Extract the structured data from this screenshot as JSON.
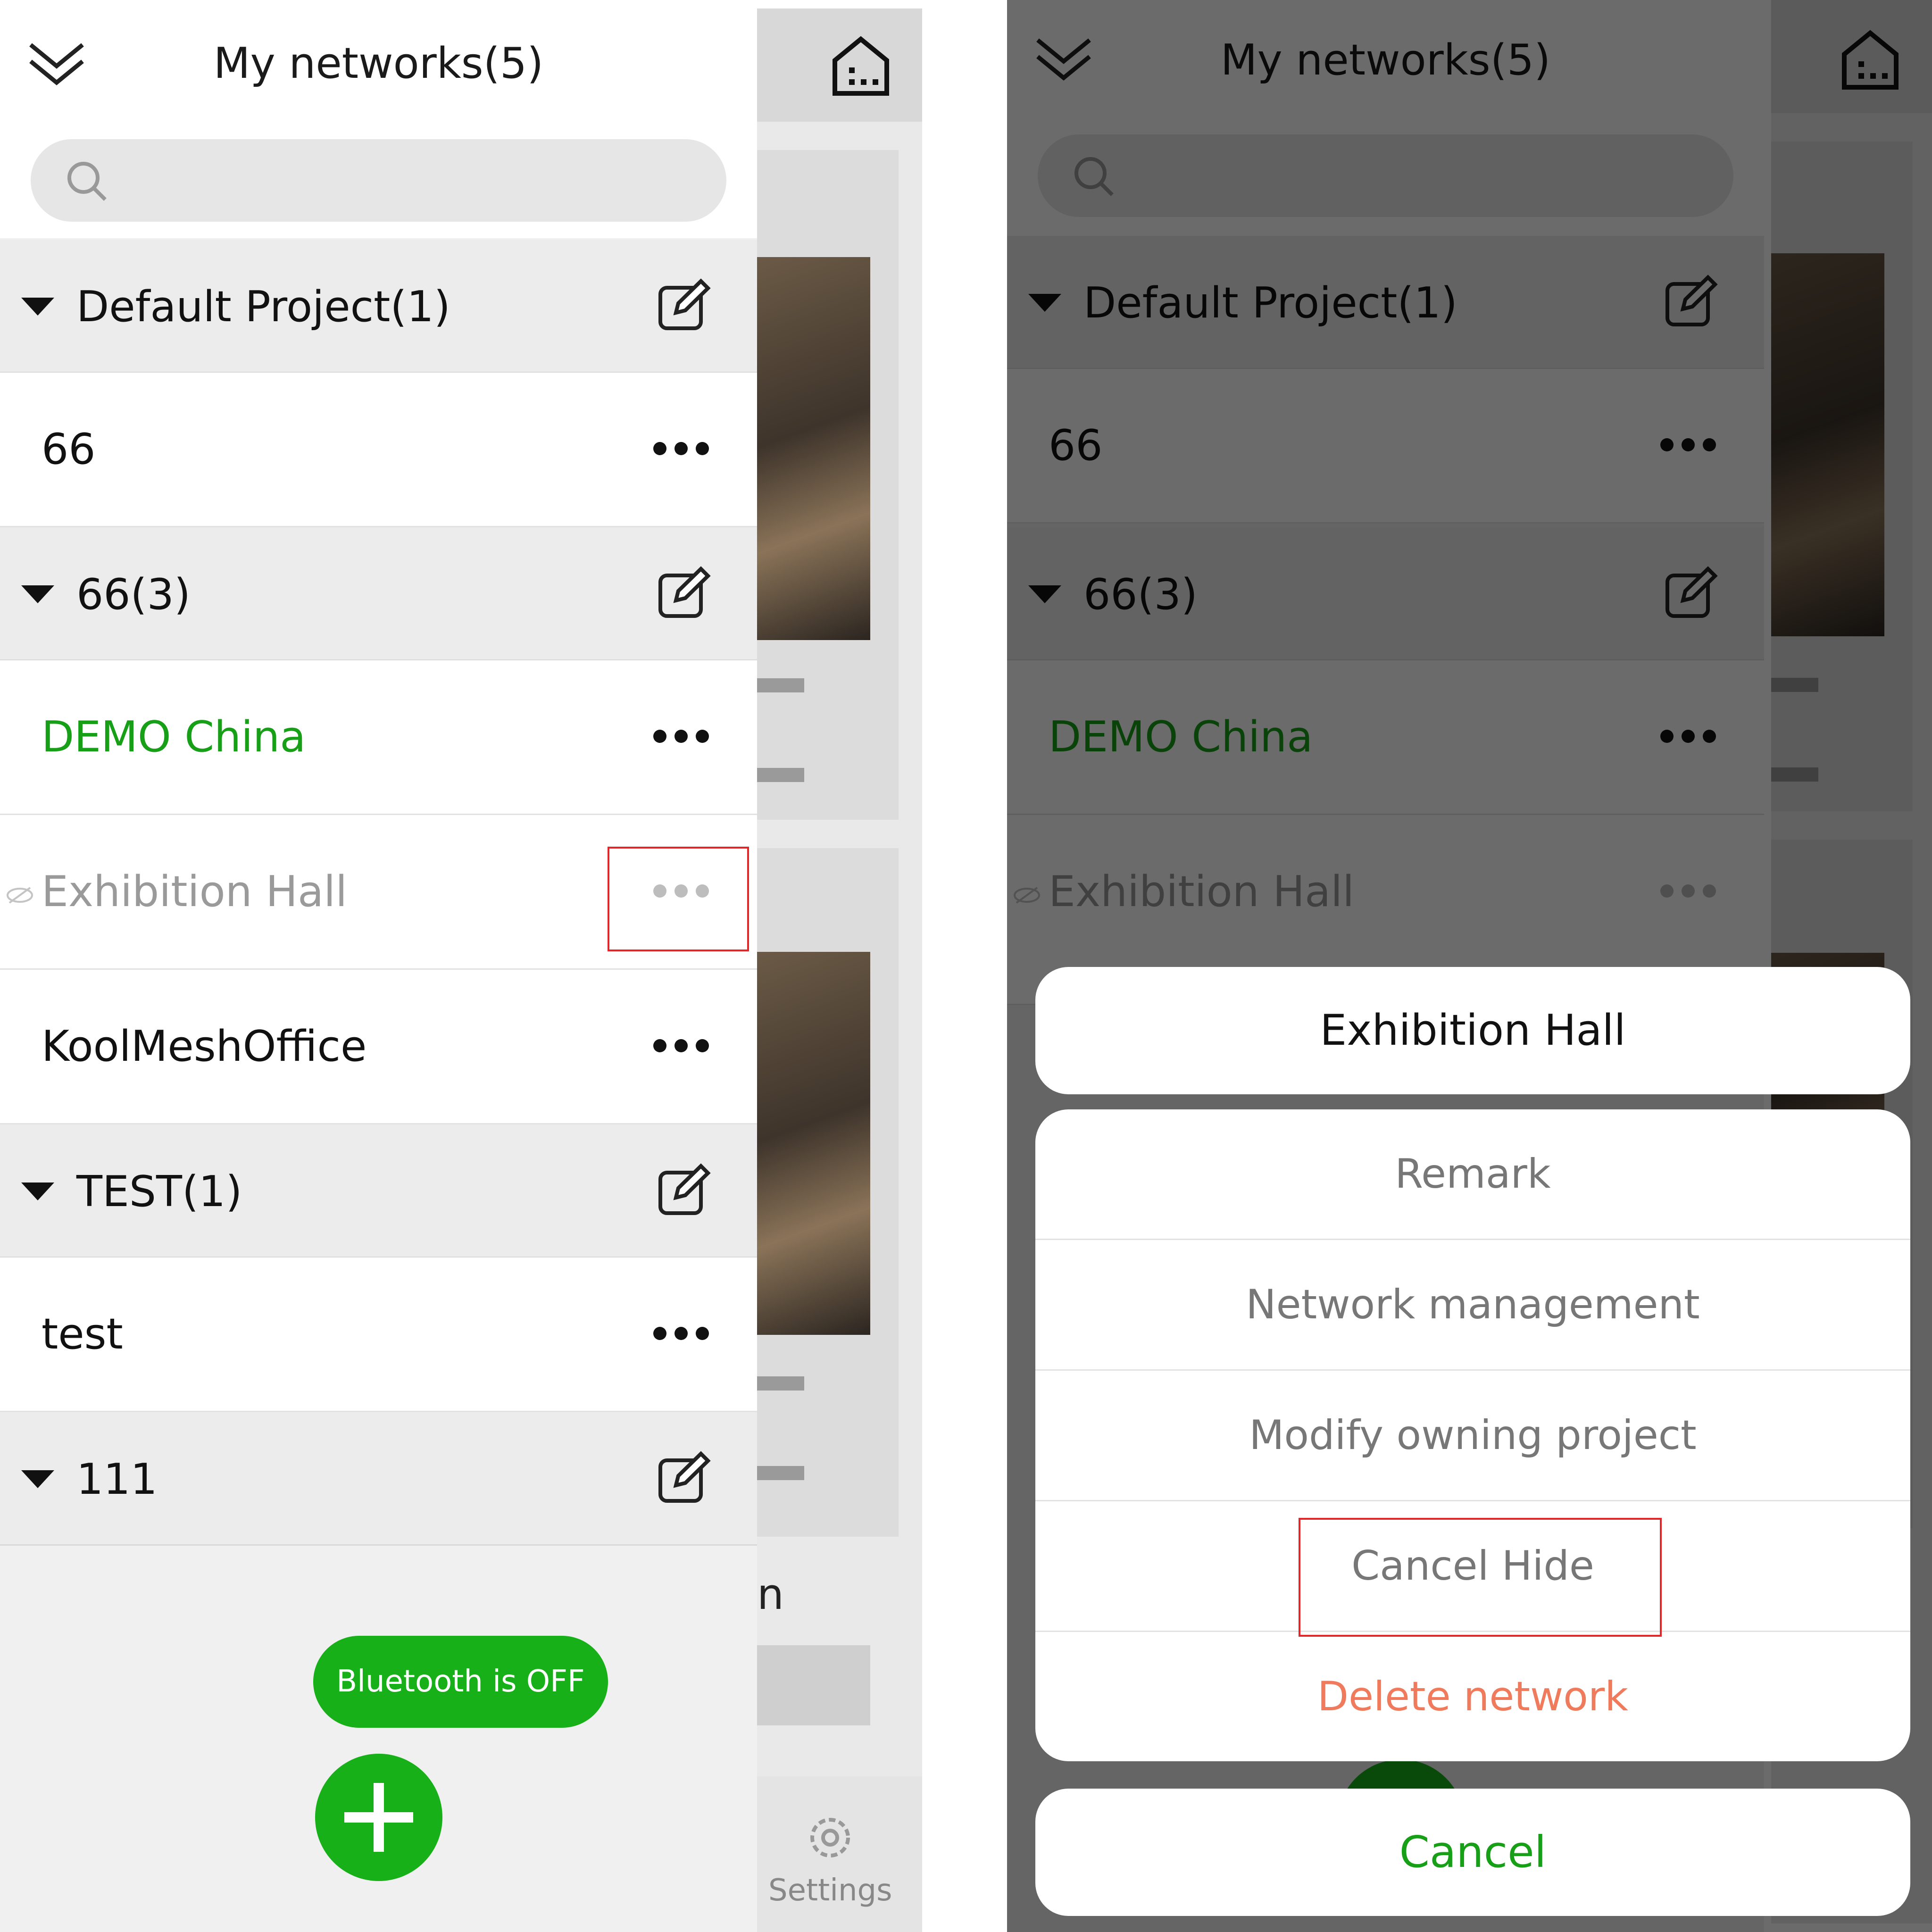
{
  "drawer": {
    "title": "My networks(5)",
    "search": {
      "placeholder": ""
    },
    "groups": [
      {
        "name": "Default Project(1)"
      },
      {
        "name": "66(3)"
      },
      {
        "name": "TEST(1)"
      },
      {
        "name": "111"
      }
    ],
    "networks": [
      {
        "name": "66",
        "state": "normal"
      },
      {
        "name": "DEMO China",
        "state": "active"
      },
      {
        "name": "Exhibition Hall",
        "state": "hidden"
      },
      {
        "name": "KoolMeshOffice",
        "state": "normal"
      },
      {
        "name": "test",
        "state": "normal"
      }
    ],
    "bluetooth_status": "Bluetooth is OFF",
    "add_label": "+"
  },
  "background": {
    "settings_label": "Settings",
    "partial_text_1": "n"
  },
  "action_sheet": {
    "title": "Exhibition Hall",
    "items": [
      "Remark",
      "Network management",
      "Modify owning project",
      "Cancel Hide",
      "Delete network"
    ],
    "cancel": "Cancel"
  },
  "colors": {
    "accent": "#17b018",
    "active_text": "#17a017",
    "danger": "#f07a5c",
    "highlight_box": "#e0282a",
    "hidden_text": "#9a9a9a"
  }
}
